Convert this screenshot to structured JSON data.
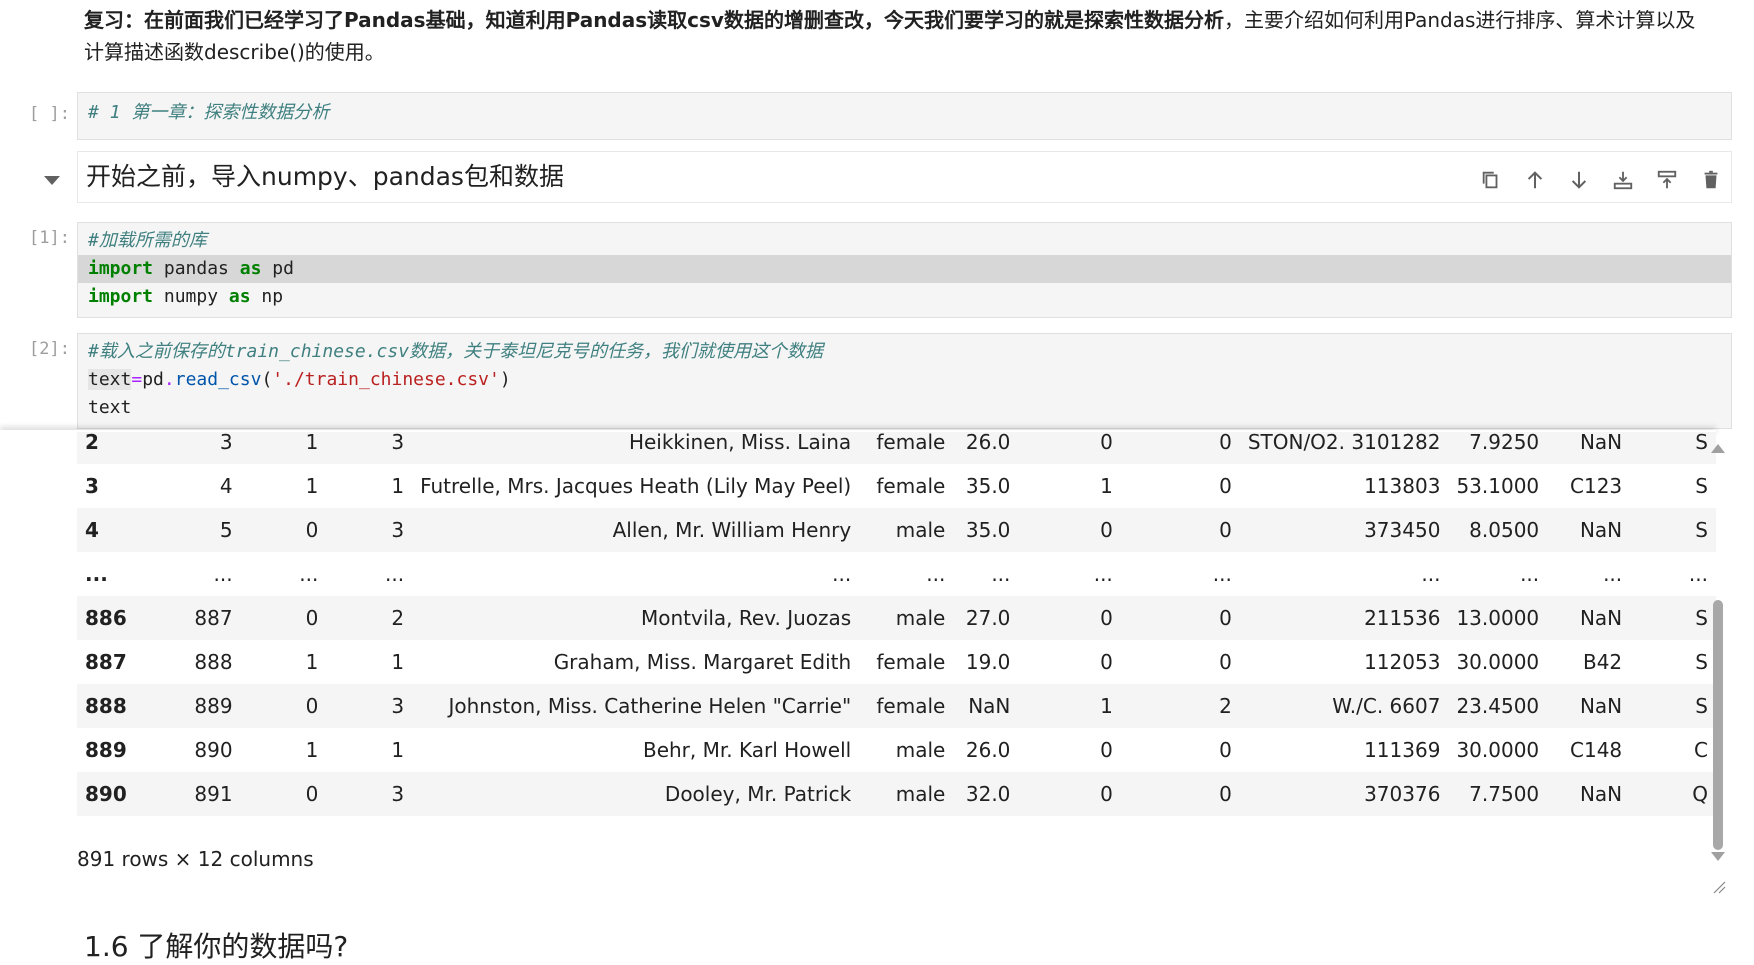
{
  "intro": {
    "bold": "复习：在前面我们已经学习了Pandas基础，知道利用Pandas读取csv数据的增删查改，今天我们要学习的就是探索性数据分析",
    "normal": "，主要介绍如何利用Pandas进行排序、算术计算以及计算描述函数describe()的使用。"
  },
  "cell1": {
    "prompt": "[ ]:",
    "line": "# 1 第一章：探索性数据分析"
  },
  "markdown_cell": {
    "text": "开始之前，导入numpy、pandas包和数据"
  },
  "toolbar": {
    "icons": [
      "duplicate-icon",
      "move-up-icon",
      "move-down-icon",
      "insert-above-icon",
      "insert-below-icon",
      "delete-icon"
    ]
  },
  "cell2": {
    "prompt": "[1]:",
    "comment": "#加载所需的库",
    "line2_kw1": "import",
    "line2_mod": " pandas ",
    "line2_kw2": "as",
    "line2_alias": " pd",
    "line3_kw1": "import",
    "line3_mod": " numpy ",
    "line3_kw2": "as",
    "line3_alias": " np"
  },
  "cell3": {
    "prompt": "[2]:",
    "comment": "#载入之前保存的train_chinese.csv数据，关于泰坦尼克号的任务，我们就使用这个数据",
    "line2_var": "text",
    "line2_eq": "=",
    "line2_obj": "pd",
    "line2_dot": ".",
    "line2_fn": "read_csv",
    "line2_open": "(",
    "line2_str": "'./train_chinese.csv'",
    "line2_close": ")",
    "line3": "text"
  },
  "table": {
    "rows": [
      [
        "2",
        "3",
        "1",
        "3",
        "Heikkinen, Miss. Laina",
        "female",
        "26.0",
        "0",
        "0",
        "STON/O2. 3101282",
        "7.9250",
        "NaN",
        "S"
      ],
      [
        "3",
        "4",
        "1",
        "1",
        "Futrelle, Mrs. Jacques Heath (Lily May Peel)",
        "female",
        "35.0",
        "1",
        "0",
        "113803",
        "53.1000",
        "C123",
        "S"
      ],
      [
        "4",
        "5",
        "0",
        "3",
        "Allen, Mr. William Henry",
        "male",
        "35.0",
        "0",
        "0",
        "373450",
        "8.0500",
        "NaN",
        "S"
      ],
      [
        "...",
        "...",
        "...",
        "...",
        "...",
        "...",
        "...",
        "...",
        "...",
        "...",
        "...",
        "...",
        "..."
      ],
      [
        "886",
        "887",
        "0",
        "2",
        "Montvila, Rev. Juozas",
        "male",
        "27.0",
        "0",
        "0",
        "211536",
        "13.0000",
        "NaN",
        "S"
      ],
      [
        "887",
        "888",
        "1",
        "1",
        "Graham, Miss. Margaret Edith",
        "female",
        "19.0",
        "0",
        "0",
        "112053",
        "30.0000",
        "B42",
        "S"
      ],
      [
        "888",
        "889",
        "0",
        "3",
        "Johnston, Miss. Catherine Helen \"Carrie\"",
        "female",
        "NaN",
        "1",
        "2",
        "W./C. 6607",
        "23.4500",
        "NaN",
        "S"
      ],
      [
        "889",
        "890",
        "1",
        "1",
        "Behr, Mr. Karl Howell",
        "male",
        "26.0",
        "0",
        "0",
        "111369",
        "30.0000",
        "C148",
        "C"
      ],
      [
        "890",
        "891",
        "0",
        "3",
        "Dooley, Mr. Patrick",
        "male",
        "32.0",
        "0",
        "0",
        "370376",
        "7.7500",
        "NaN",
        "Q"
      ]
    ],
    "row_count": "891 rows × 12 columns"
  },
  "bottom_heading": "1.6 了解你的数据吗?"
}
